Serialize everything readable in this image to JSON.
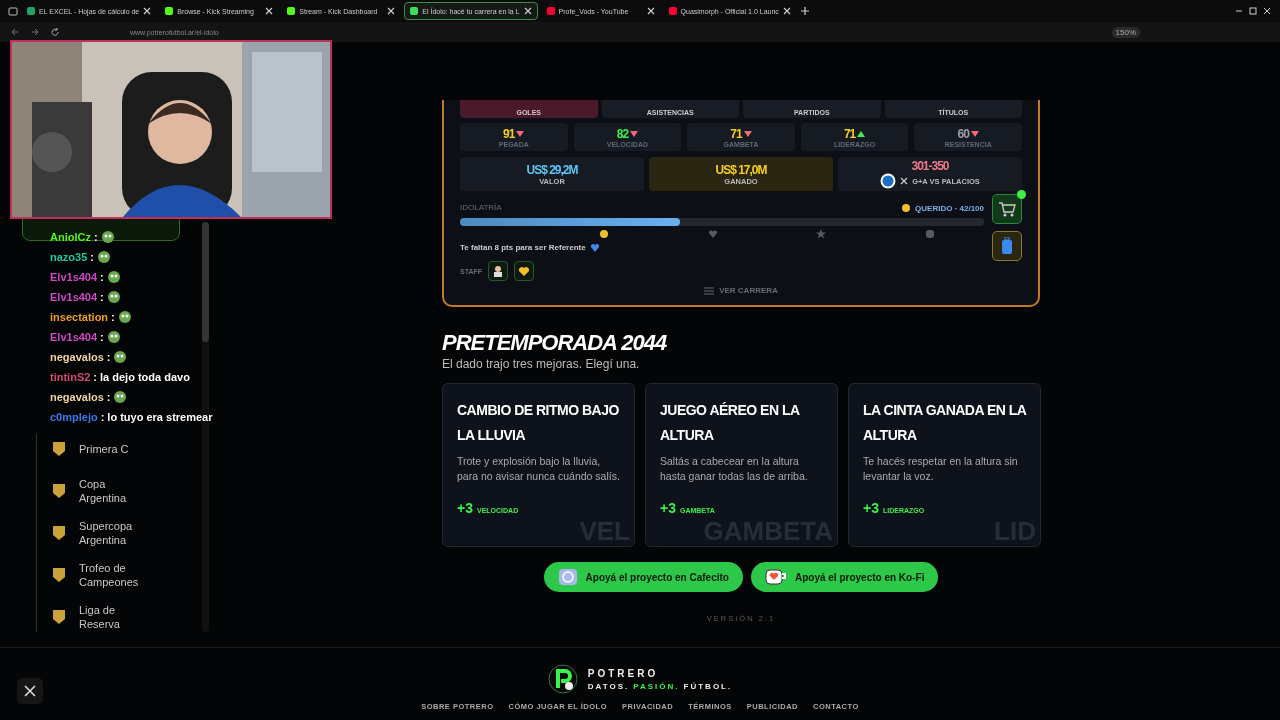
{
  "browser": {
    "tabs": [
      {
        "title": "EL EXCEL - Hojas de cálculo de",
        "selected": false,
        "color": "#1fa463"
      },
      {
        "title": "Browse - Kick Streaming",
        "selected": false,
        "color": "#53fc18"
      },
      {
        "title": "Stream - Kick Dashboard",
        "selected": false,
        "color": "#53fc18"
      },
      {
        "title": "El Ídolo: hacé tu carrera en la L",
        "selected": true,
        "color": "#3ddc5c"
      },
      {
        "title": "Profe_Vods - YouTube",
        "selected": false,
        "color": "#ff0033"
      },
      {
        "title": "Quasimorph - Official 1.0 Launc",
        "selected": false,
        "color": "#ff0033"
      }
    ],
    "url": "www.potrerofutbol.ar/el-idolo",
    "zoom": "150%"
  },
  "chat": [
    {
      "user": "AniolCz",
      "separator": ":",
      "color": "#53fc18"
    },
    {
      "user": "nazo35",
      "separator": ":",
      "color": "#1ec8a0"
    },
    {
      "user": "Elv1s404",
      "separator": ":",
      "color": "#d04ac8"
    },
    {
      "user": "Elv1s404",
      "separator": ":",
      "color": "#d04ac8"
    },
    {
      "user": "insectation",
      "separator": ":",
      "color": "#f0a020"
    },
    {
      "user": "Elv1s404",
      "separator": ":",
      "color": "#d04ac8"
    },
    {
      "user": "negavalos",
      "separator": ":",
      "color": "#f4d6a0"
    },
    {
      "user": "tintinS2",
      "separator": ":",
      "color": "#d04a78",
      "message": "la dejo toda davo"
    },
    {
      "user": "negavalos",
      "separator": ":",
      "color": "#f4d6a0"
    },
    {
      "user": "c0mplejo",
      "separator": ":",
      "color": "#3a7af0",
      "message": "lo tuyo era stremear"
    }
  ],
  "sidebar": {
    "items": [
      {
        "label": "Primera C"
      },
      {
        "label": "Copa Argentina"
      },
      {
        "label": "Supercopa Argentina"
      },
      {
        "label": "Trofeo de Campeones"
      },
      {
        "label": "Liga de Reserva"
      }
    ]
  },
  "player_card": {
    "stat_labels": [
      {
        "label": "GOLES",
        "selected": true
      },
      {
        "label": "ASISTENCIAS",
        "selected": false
      },
      {
        "label": "PARTIDOS",
        "selected": false
      },
      {
        "label": "TÍTULOS",
        "selected": false
      }
    ],
    "attributes": [
      {
        "value": "91",
        "label": "PEGADA",
        "rising": false,
        "color": "#f5d020"
      },
      {
        "value": "82",
        "label": "VELOCIDAD",
        "rising": false,
        "color": "#3df04a"
      },
      {
        "value": "71",
        "label": "GAMBETA",
        "rising": false,
        "color": "#f5d020"
      },
      {
        "value": "71",
        "label": "LIDERAZGO",
        "rising": true,
        "color": "#f5d020"
      },
      {
        "value": "60",
        "label": "RESISTENCIA",
        "rising": false,
        "color": "#9aa0aa"
      }
    ],
    "money": [
      {
        "value": "US$ 29,2M",
        "label": "VALOR",
        "kind": "value"
      },
      {
        "value": "US$ 17,0M",
        "label": "GANADO",
        "kind": "earned"
      }
    ],
    "ranking": {
      "value": "301-350",
      "label": "G+A VS PALACIOS"
    },
    "idolatria": {
      "label": "IDOLATRÍA",
      "status": "QUERIDO · 42/100",
      "level": 0.42
    },
    "hint": "Te faltan 8 pts para ser Referente",
    "staff_label": "STAFF",
    "link": "VER CARRERA"
  },
  "preseason": {
    "title": "PRETEMPORADA 2044",
    "subtitle": "El dado trajo tres mejoras. Elegí una.",
    "options": [
      {
        "title": "CAMBIO DE RITMO BAJO LA LLUVIA",
        "description": "Trote y explosión bajo la lluvia, para no avisar nunca cuándo salís.",
        "bonus": "+3",
        "stat": "VELOCIDAD",
        "watermark": "VEL"
      },
      {
        "title": "JUEGO AÉREO EN LA ALTURA",
        "description": "Saltás a cabecear en la altura hasta ganar todas las de arriba.",
        "bonus": "+3",
        "stat": "GAMBETA",
        "watermark": "GAMBETA"
      },
      {
        "title": "LA CINTA GANADA EN LA ALTURA",
        "description": "Te hacés respetar en la altura sin levantar la voz.",
        "bonus": "+3",
        "stat": "LIDERAZGO",
        "watermark": "LID"
      }
    ]
  },
  "support_buttons": [
    {
      "label": "Apoyá el proyecto en Cafecito",
      "kind": "cafecito"
    },
    {
      "label": "Apoyá el proyecto en Ko-Fi",
      "kind": "kofi"
    }
  ],
  "version": "VERSIÓN 2.1",
  "footer": {
    "brand": "POTRERO",
    "tagline": [
      {
        "text": "DATOS.",
        "highlight": false
      },
      {
        "text": "PASIÓN.",
        "highlight": true
      },
      {
        "text": "FÚTBOL.",
        "highlight": false
      }
    ],
    "links": [
      "SOBRE POTRERO",
      "CÓMO JUGAR EL ÍDOLO",
      "PRIVACIDAD",
      "TÉRMINOS",
      "PUBLICIDAD",
      "CONTACTO"
    ]
  }
}
